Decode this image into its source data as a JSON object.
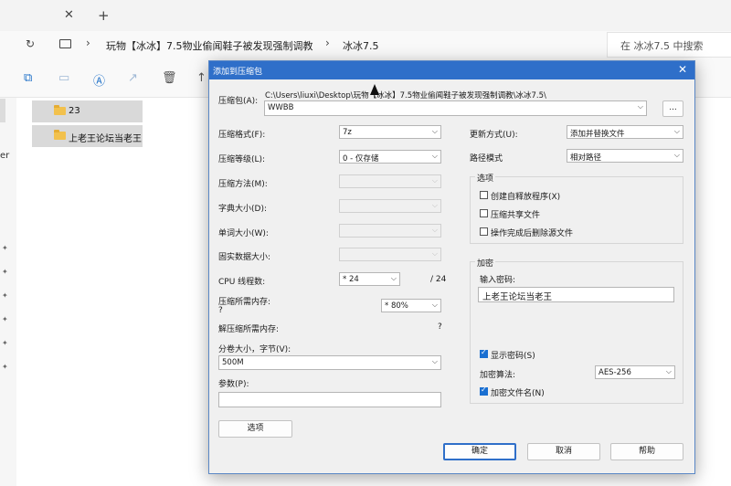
{
  "explorer": {
    "tab": {
      "close": "✕",
      "new": "+"
    },
    "breadcrumb": [
      "玩物【冰冰】7.5物业偷闻鞋子被发现强制调教",
      "冰冰7.5"
    ],
    "search_placeholder": "在 冰冰7.5 中搜索",
    "files": [
      {
        "name": "23"
      },
      {
        "name": "上老王论坛当老王"
      }
    ],
    "nav_partial": "er"
  },
  "dialog": {
    "title": "添加到压缩包",
    "archive_label": "压缩包(A):",
    "archive_path": "C:\\Users\\liuxi\\Desktop\\玩物【冰冰】7.5物业偷闻鞋子被发现强制调教\\冰冰7.5\\",
    "archive_name": "WWBB",
    "browse_label": "...",
    "left": {
      "format_label": "压缩格式(F):",
      "format_value": "7z",
      "level_label": "压缩等级(L):",
      "level_value": "0 - 仅存储",
      "method_label": "压缩方法(M):",
      "dict_label": "字典大小(D):",
      "word_label": "单词大小(W):",
      "solid_label": "固实数据大小:",
      "cpu_label": "CPU 线程数:",
      "cpu_value": "* 24",
      "cpu_total": "/ 24",
      "mem_label": "压缩所需内存:",
      "mem_q": "?",
      "mem_value": "* 80%",
      "demem_label": "解压缩所需内存:",
      "demem_q": "?",
      "split_label": "分卷大小，字节(V):",
      "split_value": "500M",
      "params_label": "参数(P):",
      "options_button": "选项"
    },
    "right": {
      "update_label": "更新方式(U):",
      "update_value": "添加并替换文件",
      "path_label": "路径模式",
      "path_value": "相对路径",
      "options_group": "选项",
      "opt_sfx": "创建自释放程序(X)",
      "opt_shared": "压缩共享文件",
      "opt_delete": "操作完成后删除源文件",
      "encrypt_group": "加密",
      "password_label": "输入密码:",
      "password_value": "上老王论坛当老王",
      "show_password": "显示密码(S)",
      "enc_method_label": "加密算法:",
      "enc_method_value": "AES-256",
      "encrypt_names": "加密文件名(N)"
    },
    "buttons": {
      "ok": "确定",
      "cancel": "取消",
      "help": "帮助"
    }
  },
  "colors": {
    "title_bar": "#2f6fc9",
    "accent": "#1a6fd1"
  }
}
